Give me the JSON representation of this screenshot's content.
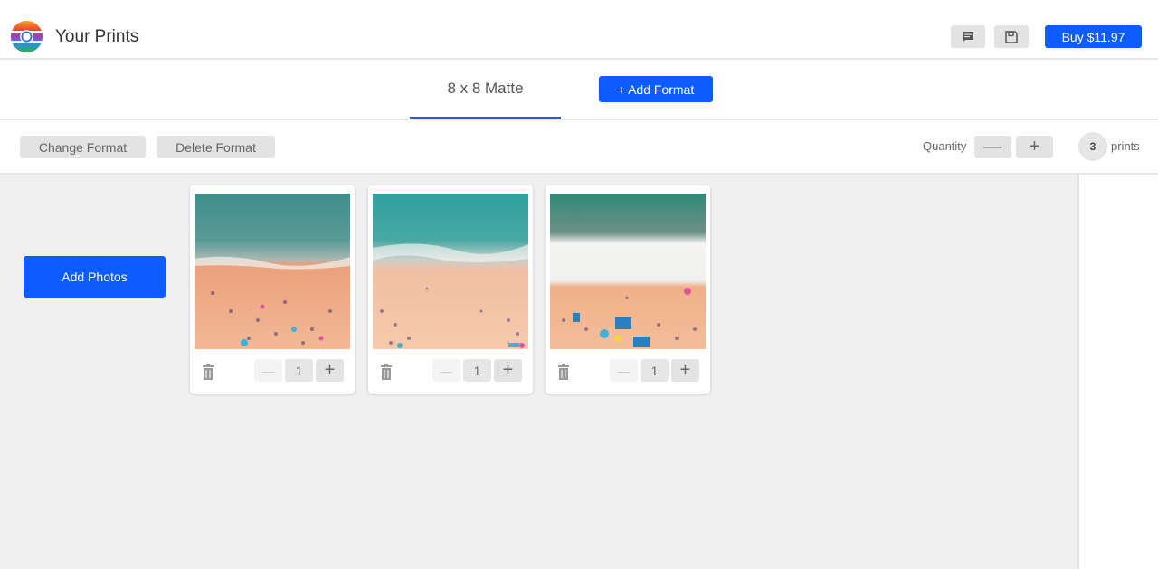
{
  "header": {
    "title": "Your Prints",
    "logo_icon": "camera-rainbow-logo",
    "chat_icon": "chat-icon",
    "save_icon": "floppy-disk-icon",
    "buy_label": "Buy $11.97",
    "accent_color": "#0d5cff"
  },
  "tabs": {
    "items": [
      {
        "label": "8 x 8 Matte",
        "active": true
      }
    ],
    "add_format_label": "+ Add Format"
  },
  "toolbar": {
    "change_format_label": "Change Format",
    "delete_format_label": "Delete Format",
    "quantity_label": "Quantity",
    "minus_label": "—",
    "plus_label": "+",
    "print_count": "3",
    "prints_label": "prints"
  },
  "main": {
    "add_photos_label": "Add Photos",
    "photos": [
      {
        "description": "aerial beach photo, crowded sand and teal water",
        "quantity": "1",
        "minus": "—",
        "plus": "+"
      },
      {
        "description": "aerial beach photo, teal water and wide sand",
        "quantity": "1",
        "minus": "—",
        "plus": "+"
      },
      {
        "description": "aerial beach photo, white surf and umbrellas",
        "quantity": "1",
        "minus": "—",
        "plus": "+"
      }
    ]
  }
}
